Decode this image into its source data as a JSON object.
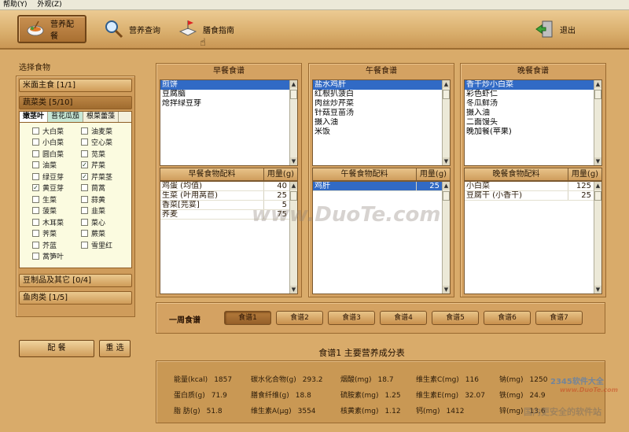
{
  "menubar": {
    "items": [
      "帮助(Y)",
      "外观(Z)"
    ]
  },
  "toolbar": {
    "nutrition_match": "营养配餐",
    "nutrition_query": "营养查询",
    "diet_guide": "膳食指南",
    "exit": "退出"
  },
  "left": {
    "title": "选择食物",
    "categories": [
      {
        "label": "米面主食 [1/1]"
      },
      {
        "label": "蔬菜类 [5/10]"
      },
      {
        "label": "豆制品及其它 [0/4]"
      },
      {
        "label": "鱼肉类 [1/5]"
      }
    ],
    "subtabs": [
      "嫩茎叶",
      "苔花瓜茄",
      "根菜蕾藻"
    ],
    "vegetables_col1": [
      {
        "name": "大白菜",
        "checked": false
      },
      {
        "name": "小白菜",
        "checked": false
      },
      {
        "name": "圆白菜",
        "checked": false
      },
      {
        "name": "油菜",
        "checked": false
      },
      {
        "name": "绿豆芽",
        "checked": false
      },
      {
        "name": "黄豆芽",
        "checked": true
      },
      {
        "name": "生菜",
        "checked": false
      },
      {
        "name": "菠菜",
        "checked": false
      },
      {
        "name": "木耳菜",
        "checked": false
      },
      {
        "name": "荠菜",
        "checked": false
      },
      {
        "name": "芥蓝",
        "checked": false
      },
      {
        "name": "蒿笋叶",
        "checked": false
      }
    ],
    "vegetables_col2": [
      {
        "name": "油麦菜",
        "checked": false
      },
      {
        "name": "空心菜",
        "checked": false
      },
      {
        "name": "苋菜",
        "checked": false
      },
      {
        "name": "芹菜",
        "checked": true
      },
      {
        "name": "芹菜茎",
        "checked": true
      },
      {
        "name": "茼蒿",
        "checked": false
      },
      {
        "name": "蒜黄",
        "checked": false
      },
      {
        "name": "韭菜",
        "checked": false
      },
      {
        "name": "菜心",
        "checked": false
      },
      {
        "name": "蕨菜",
        "checked": false
      },
      {
        "name": "雪里红",
        "checked": false
      }
    ],
    "check_mark": "✓",
    "match_button": "配  餐",
    "reset_button": "重 选"
  },
  "meals": [
    {
      "title": "早餐食谱",
      "recipes": [
        "煎饼",
        "豆腐脑",
        "炝拌绿豆芽"
      ],
      "ing_header": "早餐食物配料",
      "amount_header": "用量(g)",
      "ingredients": [
        {
          "name": "鸡蛋 (均值)",
          "amount": "40"
        },
        {
          "name": "生菜 (叶用莴苣)",
          "amount": "25"
        },
        {
          "name": "香菜[芫荽]",
          "amount": "5"
        },
        {
          "name": "荞麦",
          "amount": "75"
        }
      ]
    },
    {
      "title": "午餐食谱",
      "recipes": [
        "盐水鸡肝",
        "红根扒菠白",
        "肉丝炒芹菜",
        "针菇豆苗汤",
        "摄入油",
        "米饭"
      ],
      "ing_header": "午餐食物配料",
      "amount_header": "用量(g)",
      "ingredients": [
        {
          "name": "鸡肝",
          "amount": "25"
        }
      ]
    },
    {
      "title": "晚餐食谱",
      "recipes": [
        "香干炒小白菜",
        "彩色虾仁",
        "冬瓜鲜汤",
        "摄入油",
        "二面馒头",
        "晚加餐(苹果)"
      ],
      "ing_header": "晚餐食物配料",
      "amount_header": "用量(g)",
      "ingredients": [
        {
          "name": "小白菜",
          "amount": "125"
        },
        {
          "name": "豆腐干 (小香干)",
          "amount": "25"
        }
      ]
    }
  ],
  "week": {
    "label": "一周食谱",
    "buttons": [
      "食谱1",
      "食谱2",
      "食谱3",
      "食谱4",
      "食谱5",
      "食谱6",
      "食谱7"
    ],
    "selected_index": 0
  },
  "nutrition": {
    "title": "食谱1 主要营养成分表",
    "rows": [
      [
        {
          "label": "能量(kcal)",
          "value": "1857"
        },
        {
          "label": "碳水化合物(g)",
          "value": "293.2"
        },
        {
          "label": "烟酸(mg)",
          "value": "18.7"
        },
        {
          "label": "维生素C(mg)",
          "value": "116"
        },
        {
          "label": "钠(mg)",
          "value": "1250"
        }
      ],
      [
        {
          "label": "蛋白质(g)",
          "value": "71.9"
        },
        {
          "label": "膳食纤维(g)",
          "value": "18.8"
        },
        {
          "label": "硫胺素(mg)",
          "value": "1.25"
        },
        {
          "label": "维生素E(mg)",
          "value": "32.07"
        },
        {
          "label": "铁(mg)",
          "value": "24.9"
        }
      ],
      [
        {
          "label": "脂 肪(g)",
          "value": "51.8"
        },
        {
          "label": "维生素A(μg)",
          "value": "3554"
        },
        {
          "label": "核黄素(mg)",
          "value": "1.12"
        },
        {
          "label": "钙(mg)",
          "value": "1412"
        },
        {
          "label": "锌(mg)",
          "value": "13.6"
        }
      ]
    ]
  },
  "watermarks": {
    "center": "www.DuoTe.com",
    "corner_top": "2345软件大全",
    "corner_url": "www.DuoTe.com",
    "corner_bottom": "国内更安全的软件站"
  }
}
